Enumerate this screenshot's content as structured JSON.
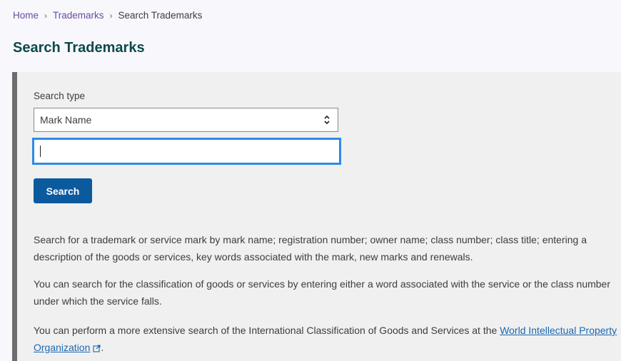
{
  "breadcrumb": {
    "items": [
      {
        "label": "Home",
        "link": true
      },
      {
        "label": "Trademarks",
        "link": true
      },
      {
        "label": "Search Trademarks",
        "link": false
      }
    ],
    "separator": "›"
  },
  "page": {
    "title": "Search Trademarks"
  },
  "form": {
    "search_type_label": "Search type",
    "search_type_value": "Mark Name",
    "search_input_value": "",
    "search_button_label": "Search"
  },
  "info": {
    "paragraph1": "Search for a trademark or service mark by mark name; registration number; owner name; class number; class title; entering a description of the goods or services, key words associated with the mark, new marks and renewals.",
    "paragraph2": "You can search for the classification of goods or services by entering either a word associated with the service or the class number under which the service falls.",
    "paragraph3_prefix": "You can perform a more extensive search of the International Classification of Goods and Services at the ",
    "paragraph3_link": "World Intellectual Property Organization",
    "paragraph3_suffix": "."
  },
  "colors": {
    "link": "#6a4c9c",
    "title": "#0c4a4a",
    "button": "#0b5a9e",
    "focus": "#2e8ae6",
    "panel_border": "#6d6d6d"
  }
}
